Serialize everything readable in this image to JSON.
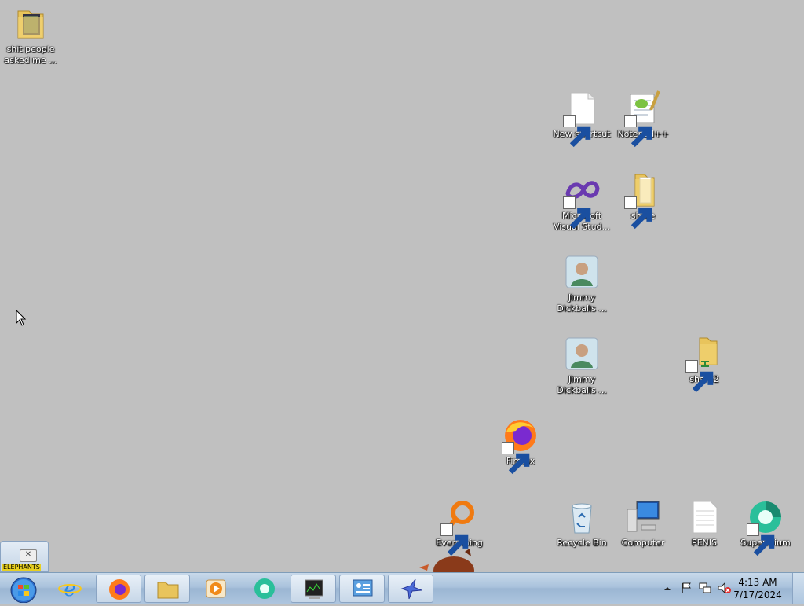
{
  "desktop": {
    "icons": {
      "folder_people": "shit people asked me ...",
      "new_shortcut": "New shortcut",
      "notepadpp": "Notepad++",
      "visual_studio": "Microsoft Visual Stud...",
      "share": "share",
      "jimmy1": "Jimmy Dickballs ...",
      "jimmy2": "Jimmy Dickballs ...",
      "share2": "share2",
      "firefox": "Firefox",
      "everything": "Everything",
      "recycle_bin": "Recycle Bin",
      "computer": "Computer",
      "penis": "PENIS",
      "supermium": "Supermium"
    }
  },
  "taskbar": {
    "clock_time": "4:13 AM",
    "clock_date": "7/17/2024",
    "notice_text": "ELEPHANTS"
  },
  "colors": {
    "desktop": "#c0c0c0",
    "taskbar": "#a9c2dc",
    "accent": "#3a6ea5"
  }
}
